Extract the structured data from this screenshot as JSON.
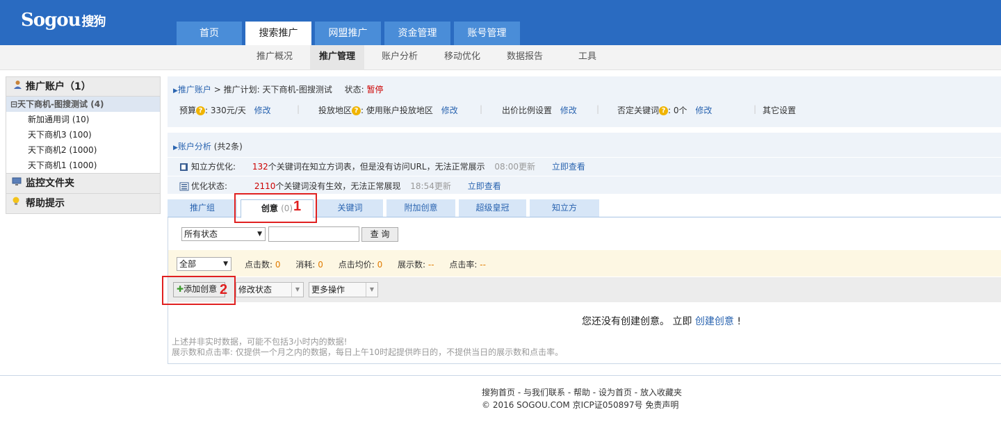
{
  "brand": {
    "logo": "Sogou",
    "logo_cn": "搜狗"
  },
  "main_tabs": [
    "首页",
    "搜索推广",
    "网盟推广",
    "资金管理",
    "账号管理"
  ],
  "sub_nav": [
    "推广概况",
    "推广管理",
    "账户分析",
    "移动优化",
    "数据报告",
    "工具"
  ],
  "sidebar": {
    "account_title": "推广账户（1）",
    "plan": "⊟天下商机-图搜测试 (4)",
    "groups": [
      {
        "name": "新加通用词",
        "count": "(10)"
      },
      {
        "name": "天下商机3",
        "count": "(100)"
      },
      {
        "name": "天下商机2",
        "count": "(1000)"
      },
      {
        "name": "天下商机1",
        "count": "(1000)"
      }
    ],
    "monitor": "监控文件夹",
    "help": "帮助提示"
  },
  "breadcrumb": {
    "account": "推广账户",
    "gt": " > ",
    "plan_prefix": "推广计划: 天下商机-图搜测试",
    "status_label": "状态: ",
    "status_value": "暂停"
  },
  "settings": {
    "budget_label": "预算",
    "budget_value": ": 330元/天",
    "modify": "修改",
    "region_label": "投放地区",
    "region_value": ": 使用账户投放地区",
    "bid_ratio": "出价比例设置",
    "neg_label": "否定关键词",
    "neg_value": ": 0个",
    "other": "其它设置",
    "divider": "|"
  },
  "analysis": {
    "title": "账户分析",
    "count": " (共2条)",
    "row1_label": "知立方优化:",
    "row1_num": "132",
    "row1_text": "个关键词在知立方词表，但是没有访问URL，无法正常展示",
    "row1_time": "08:00更新",
    "row2_label": "优化状态:",
    "row2_num": "2110",
    "row2_text": "个关键词没有生效，无法正常展现",
    "row2_time": "18:54更新",
    "view": "立即查看"
  },
  "tabs": {
    "group": "推广组",
    "creative": "创意",
    "creative_count": "(0)",
    "keyword": "关键词",
    "extra": "附加创意",
    "crown": "超级皇冠",
    "cube": "知立方"
  },
  "marks": {
    "one": "1",
    "two": "2"
  },
  "filter": {
    "status_select": "所有状态",
    "search_btn": "查 询"
  },
  "stats": {
    "range": "全部",
    "clicks_label": "点击数:",
    "clicks_val": "0",
    "cost_label": "消耗:",
    "cost_val": "0",
    "cpc_label": "点击均价:",
    "cpc_val": "0",
    "impr_label": "展示数:",
    "impr_val": "--",
    "ctr_label": "点击率:",
    "ctr_val": "--"
  },
  "ops": {
    "add": "添加创意",
    "modify_status": "修改状态",
    "more_ops": "更多操作"
  },
  "empty": {
    "prefix": "您还没有创建创意。 立即 ",
    "link": "创建创意",
    "suffix": " !"
  },
  "notes": {
    "line1": "上述并非实时数据，可能不包括3小时内的数据!",
    "line2": "展示数和点击率: 仅提供一个月之内的数据，每日上午10时起提供昨日的，不提供当日的展示数和点击率。"
  },
  "footer": {
    "links": [
      "搜狗首页",
      "与我们联系",
      "帮助",
      "设为首页",
      "放入收藏夹"
    ],
    "dash": " - ",
    "copyright": "© 2016 SOGOU.COM 京ICP证050897号 免责声明"
  },
  "colors": {
    "header_blue": "#2a6bc1",
    "link_blue": "#2a64b0",
    "alert_red": "#cc0000",
    "stat_orange": "#e07b00"
  }
}
